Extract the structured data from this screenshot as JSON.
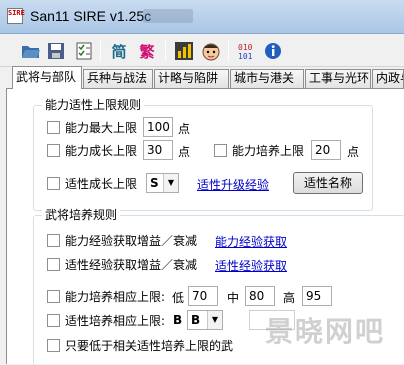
{
  "window": {
    "app_icon_text": "SIRE",
    "title": "San11 SIRE v1.25c"
  },
  "toolbar": {
    "buttons": [
      {
        "icon": "open-folder-icon"
      },
      {
        "icon": "save-disk-icon"
      },
      {
        "icon": "checklist-icon"
      },
      {
        "label": "简"
      },
      {
        "label": "繁"
      },
      {
        "icon": "chart-icon"
      },
      {
        "icon": "face-icon"
      },
      {
        "icon": "binary-icon"
      },
      {
        "icon": "info-icon"
      }
    ]
  },
  "tabs": [
    "武将与部队",
    "兵种与战法",
    "计略与陷阱",
    "城市与港关",
    "工事与光环",
    "内政与"
  ],
  "group1": {
    "title": "能力适性上限规则",
    "max_cap_label": "能力最大上限",
    "max_cap_value": "100",
    "max_cap_unit": "点",
    "growth_cap_label": "能力成长上限",
    "growth_cap_value": "30",
    "growth_cap_unit": "点",
    "train_cap_label": "能力培养上限",
    "train_cap_value": "20",
    "train_cap_unit": "点",
    "apt_growth_label": "适性成长上限",
    "apt_growth_value": "S",
    "apt_link": "适性升级经验",
    "apt_name_button": "适性名称"
  },
  "group2": {
    "title": "武将培养规则",
    "exp_gain_label": "能力经验获取增益／衰减",
    "exp_gain_link": "能力经验获取",
    "apt_exp_label": "适性经验获取增益／衰减",
    "apt_exp_link": "适性经验获取",
    "train_limit_label": "能力培养相应上限:",
    "low_label": "低",
    "low_value": "70",
    "mid_label": "中",
    "mid_value": "80",
    "high_label": "高",
    "high_value": "95",
    "apt_train_label": "适性培养相应上限:",
    "apt_train_b": "B",
    "apt_train_combo": "B",
    "only_lower_label": "只要低于相关适性培养上限的武"
  },
  "watermark": "景晓网吧"
}
